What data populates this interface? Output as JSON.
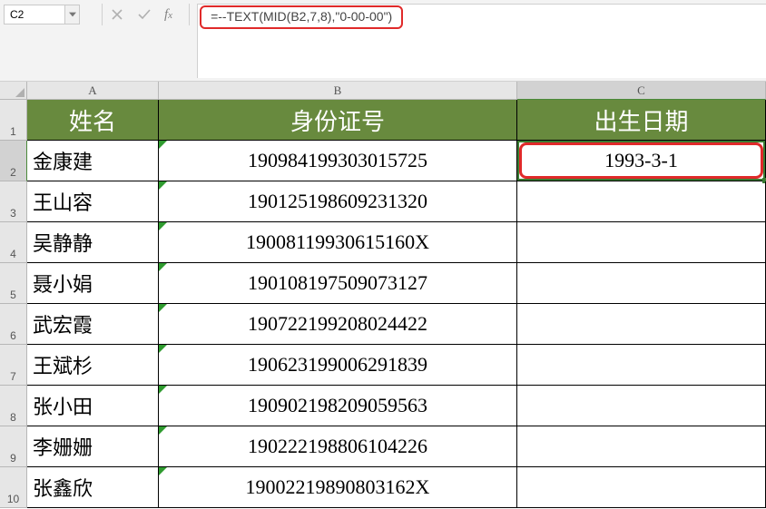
{
  "name_box": {
    "value": "C2"
  },
  "formula_bar": {
    "formula": "=--TEXT(MID(B2,7,8),\"0-00-00\")"
  },
  "columns": {
    "A": "A",
    "B": "B",
    "C": "C"
  },
  "header_row": {
    "A": "姓名",
    "B": "身份证号",
    "C": "出生日期"
  },
  "rows": [
    {
      "n": "1"
    },
    {
      "n": "2",
      "A": "金康建",
      "B": "190984199303015725",
      "C": "1993-3-1"
    },
    {
      "n": "3",
      "A": "王山容",
      "B": "190125198609231320",
      "C": ""
    },
    {
      "n": "4",
      "A": "吴静静",
      "B": "19008119930615160X",
      "C": ""
    },
    {
      "n": "5",
      "A": "聂小娟",
      "B": "190108197509073127",
      "C": ""
    },
    {
      "n": "6",
      "A": "武宏霞",
      "B": "190722199208024422",
      "C": ""
    },
    {
      "n": "7",
      "A": "王斌杉",
      "B": "190623199006291839",
      "C": ""
    },
    {
      "n": "8",
      "A": "张小田",
      "B": "190902198209059563",
      "C": ""
    },
    {
      "n": "9",
      "A": "李姗姗",
      "B": "190222198806104226",
      "C": ""
    },
    {
      "n": "10",
      "A": "张鑫欣",
      "B": "19002219890803162X",
      "C": ""
    }
  ],
  "active_cell": "C2"
}
